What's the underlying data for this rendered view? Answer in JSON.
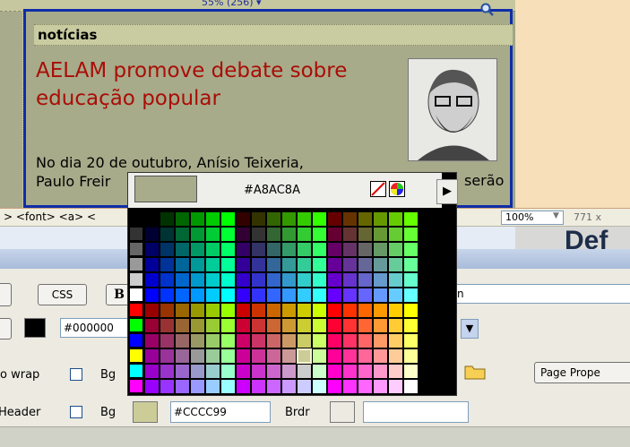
{
  "design": {
    "width_label": "55% (256) ▾",
    "section_title": "notícias",
    "headline": "AELAM promove debate sobre educação popular",
    "paragraph_line1": "No dia 20 de outubro, Anísio Teixeria,",
    "paragraph_line2": "Paulo Freir",
    "paragraph_right": "serão"
  },
  "tagbar": {
    "text": "> <font> <a> <",
    "zoom": "100%",
    "size": "771 x"
  },
  "header": {
    "def_text": "Def"
  },
  "picker": {
    "current_hex": "#A8AC8A",
    "current_color": "#A8AC8A",
    "selected_color": "#CCCC99"
  },
  "props": {
    "css_label": "CSS",
    "bold_label": "B",
    "text_color_value": "#000000",
    "text_color": "#000000",
    "nowrap_label": "o wrap",
    "header_label": "Header",
    "bg_label": "Bg",
    "bg_label2": "Bg",
    "bg_value": "#CCCC99",
    "brdr_label": "Brdr",
    "page_properties_label": "Page Prope",
    "link_partial": "n"
  }
}
